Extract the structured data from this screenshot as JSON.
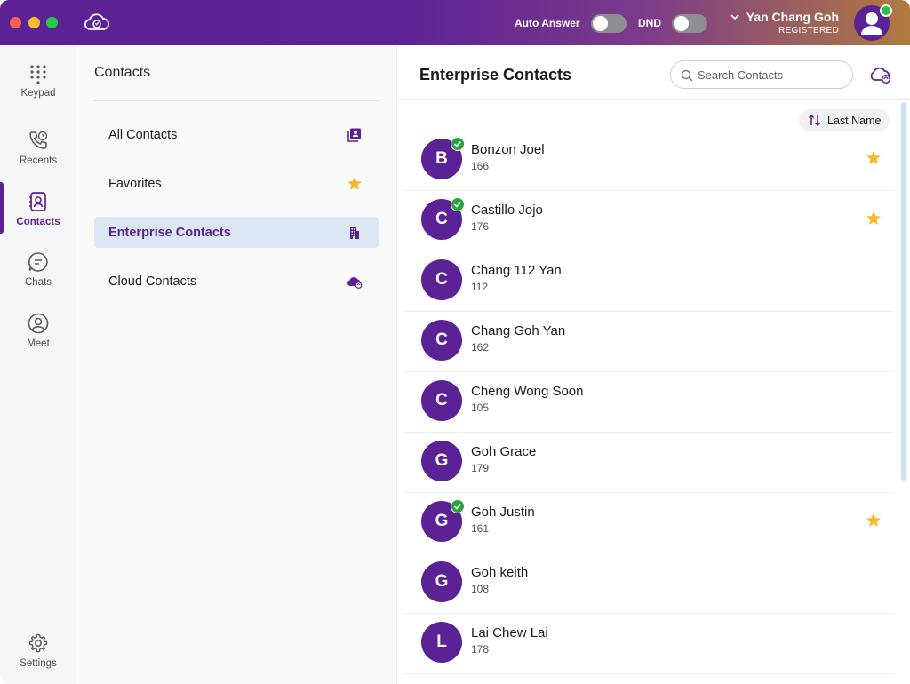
{
  "titlebar": {
    "auto_answer_label": "Auto Answer",
    "dnd_label": "DND",
    "user_name": "Yan Chang Goh",
    "user_status": "REGISTERED"
  },
  "rail": {
    "items": [
      {
        "label": "Keypad",
        "icon": "keypad-icon"
      },
      {
        "label": "Recents",
        "icon": "phone-clock-icon"
      },
      {
        "label": "Contacts",
        "icon": "contacts-book-icon",
        "active": true
      },
      {
        "label": "Chats",
        "icon": "chat-bubble-icon"
      },
      {
        "label": "Meet",
        "icon": "person-circle-icon"
      }
    ],
    "settings_label": "Settings"
  },
  "panel": {
    "title": "Contacts",
    "categories": [
      {
        "label": "All Contacts",
        "icon": "contacts-list-icon"
      },
      {
        "label": "Favorites",
        "icon": "star-icon"
      },
      {
        "label": "Enterprise Contacts",
        "icon": "building-icon",
        "active": true
      },
      {
        "label": "Cloud Contacts",
        "icon": "cloud-sync-icon"
      }
    ]
  },
  "main": {
    "title": "Enterprise Contacts",
    "search_placeholder": "Search Contacts",
    "sort_label": "Last Name",
    "contacts": [
      {
        "initial": "B",
        "name": "Bonzon Joel",
        "ext": "166",
        "online": true,
        "favorite": true
      },
      {
        "initial": "C",
        "name": "Castillo Jojo",
        "ext": "176",
        "online": true,
        "favorite": true
      },
      {
        "initial": "C",
        "name": "Chang 112 Yan",
        "ext": "112",
        "online": false,
        "favorite": false
      },
      {
        "initial": "C",
        "name": "Chang Goh Yan",
        "ext": "162",
        "online": false,
        "favorite": false
      },
      {
        "initial": "C",
        "name": "Cheng Wong Soon",
        "ext": "105",
        "online": false,
        "favorite": false
      },
      {
        "initial": "G",
        "name": "Goh Grace",
        "ext": "179",
        "online": false,
        "favorite": false
      },
      {
        "initial": "G",
        "name": "Goh Justin",
        "ext": "161",
        "online": true,
        "favorite": true
      },
      {
        "initial": "G",
        "name": "Goh keith",
        "ext": "108",
        "online": false,
        "favorite": false
      },
      {
        "initial": "L",
        "name": "Lai Chew Lai",
        "ext": "178",
        "online": false,
        "favorite": false
      }
    ]
  },
  "colors": {
    "brand": "#5b2296",
    "online": "#29a33d",
    "star": "#f5b82e",
    "active_bg": "#dce7f5"
  }
}
